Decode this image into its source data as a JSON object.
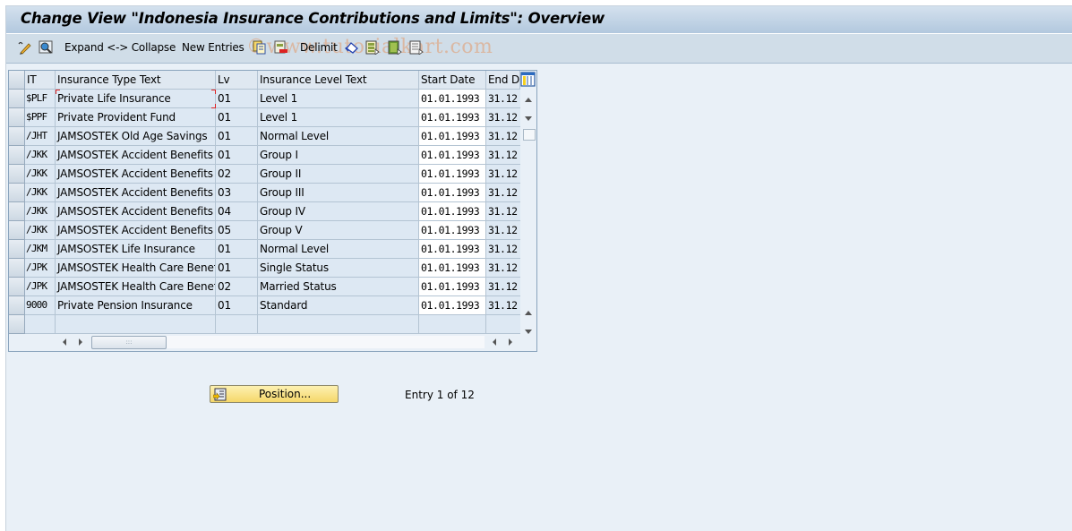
{
  "window": {
    "title": "Change View \"Indonesia Insurance Contributions and Limits\": Overview"
  },
  "toolbar": {
    "items": [
      {
        "name": "display-change-icon",
        "type": "icon"
      },
      {
        "name": "other-view-icon",
        "type": "icon"
      },
      {
        "name": "expand-collapse",
        "type": "text",
        "label": "Expand <-> Collapse"
      },
      {
        "name": "new-entries",
        "type": "text",
        "label": "New Entries"
      },
      {
        "name": "copy-as-icon",
        "type": "icon"
      },
      {
        "name": "delete-icon",
        "type": "icon"
      },
      {
        "name": "delimit",
        "type": "text",
        "label": "Delimit"
      },
      {
        "name": "undo-change-icon",
        "type": "icon"
      },
      {
        "name": "select-all-icon",
        "type": "icon"
      },
      {
        "name": "select-block-icon",
        "type": "icon"
      },
      {
        "name": "deselect-all-icon",
        "type": "icon"
      }
    ],
    "watermark": "©www.tutorialkart.com"
  },
  "table": {
    "columns": [
      {
        "key": "it",
        "label": "IT"
      },
      {
        "key": "type_text",
        "label": "Insurance Type Text"
      },
      {
        "key": "lv",
        "label": "Lv"
      },
      {
        "key": "level_text",
        "label": "Insurance Level Text"
      },
      {
        "key": "start",
        "label": "Start Date"
      },
      {
        "key": "end",
        "label": "End D"
      }
    ],
    "rows": [
      {
        "it": "$PLF",
        "type_text": "Private Life Insurance",
        "lv": "01",
        "level_text": "Level 1",
        "start": "01.01.1993",
        "end": "31.12"
      },
      {
        "it": "$PPF",
        "type_text": "Private Provident Fund",
        "lv": "01",
        "level_text": "Level 1",
        "start": "01.01.1993",
        "end": "31.12"
      },
      {
        "it": "/JHT",
        "type_text": "JAMSOSTEK Old Age Savings",
        "lv": "01",
        "level_text": "Normal Level",
        "start": "01.01.1993",
        "end": "31.12"
      },
      {
        "it": "/JKK",
        "type_text": "JAMSOSTEK Accident Benefits",
        "lv": "01",
        "level_text": "Group I",
        "start": "01.01.1993",
        "end": "31.12"
      },
      {
        "it": "/JKK",
        "type_text": "JAMSOSTEK Accident Benefits",
        "lv": "02",
        "level_text": "Group II",
        "start": "01.01.1993",
        "end": "31.12"
      },
      {
        "it": "/JKK",
        "type_text": "JAMSOSTEK Accident Benefits",
        "lv": "03",
        "level_text": "Group III",
        "start": "01.01.1993",
        "end": "31.12"
      },
      {
        "it": "/JKK",
        "type_text": "JAMSOSTEK Accident Benefits",
        "lv": "04",
        "level_text": "Group IV",
        "start": "01.01.1993",
        "end": "31.12"
      },
      {
        "it": "/JKK",
        "type_text": "JAMSOSTEK Accident Benefits",
        "lv": "05",
        "level_text": "Group V",
        "start": "01.01.1993",
        "end": "31.12"
      },
      {
        "it": "/JKM",
        "type_text": "JAMSOSTEK Life Insurance",
        "lv": "01",
        "level_text": "Normal Level",
        "start": "01.01.1993",
        "end": "31.12"
      },
      {
        "it": "/JPK",
        "type_text": "JAMSOSTEK Health Care Benefi…",
        "lv": "01",
        "level_text": "Single Status",
        "start": "01.01.1993",
        "end": "31.12"
      },
      {
        "it": "/JPK",
        "type_text": "JAMSOSTEK Health Care Benefi…",
        "lv": "02",
        "level_text": "Married Status",
        "start": "01.01.1993",
        "end": "31.12"
      },
      {
        "it": "9000",
        "type_text": "Private Pension Insurance",
        "lv": "01",
        "level_text": "Standard",
        "start": "01.01.1993",
        "end": "31.12"
      },
      {
        "it": "",
        "type_text": "",
        "lv": "",
        "level_text": "",
        "start": "",
        "end": ""
      }
    ]
  },
  "footer": {
    "position_button": "Position...",
    "entry_info": "Entry 1 of 12"
  }
}
